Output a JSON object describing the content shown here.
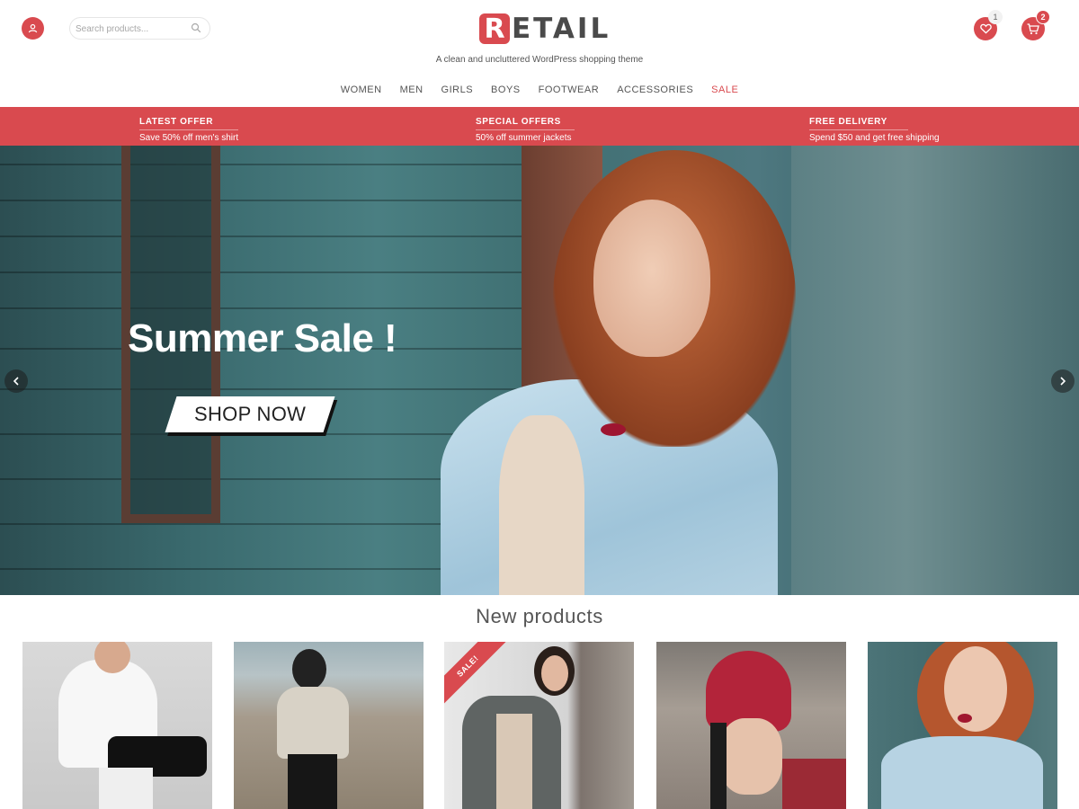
{
  "header": {
    "search_placeholder": "Search products...",
    "logo_initial": "R",
    "logo_rest": "ETAIL",
    "tagline": "A clean and uncluttered WordPress shopping theme",
    "wishlist_count": "1",
    "cart_count": "2"
  },
  "nav": {
    "items": [
      "WOMEN",
      "MEN",
      "GIRLS",
      "BOYS",
      "FOOTWEAR",
      "ACCESSORIES",
      "SALE"
    ]
  },
  "offers": [
    {
      "title": "LATEST OFFER",
      "subtitle": "Save 50% off men's shirt"
    },
    {
      "title": "SPECIAL OFFERS",
      "subtitle": "50% off summer jackets"
    },
    {
      "title": "FREE DELIVERY",
      "subtitle": "Spend $50 and get free shipping"
    }
  ],
  "hero": {
    "title": "Summer Sale !",
    "button_label": "SHOP NOW"
  },
  "products": {
    "section_title": "New products",
    "sale_badge": "SALE!"
  },
  "colors": {
    "accent": "#d94a4f",
    "text": "#555555"
  }
}
